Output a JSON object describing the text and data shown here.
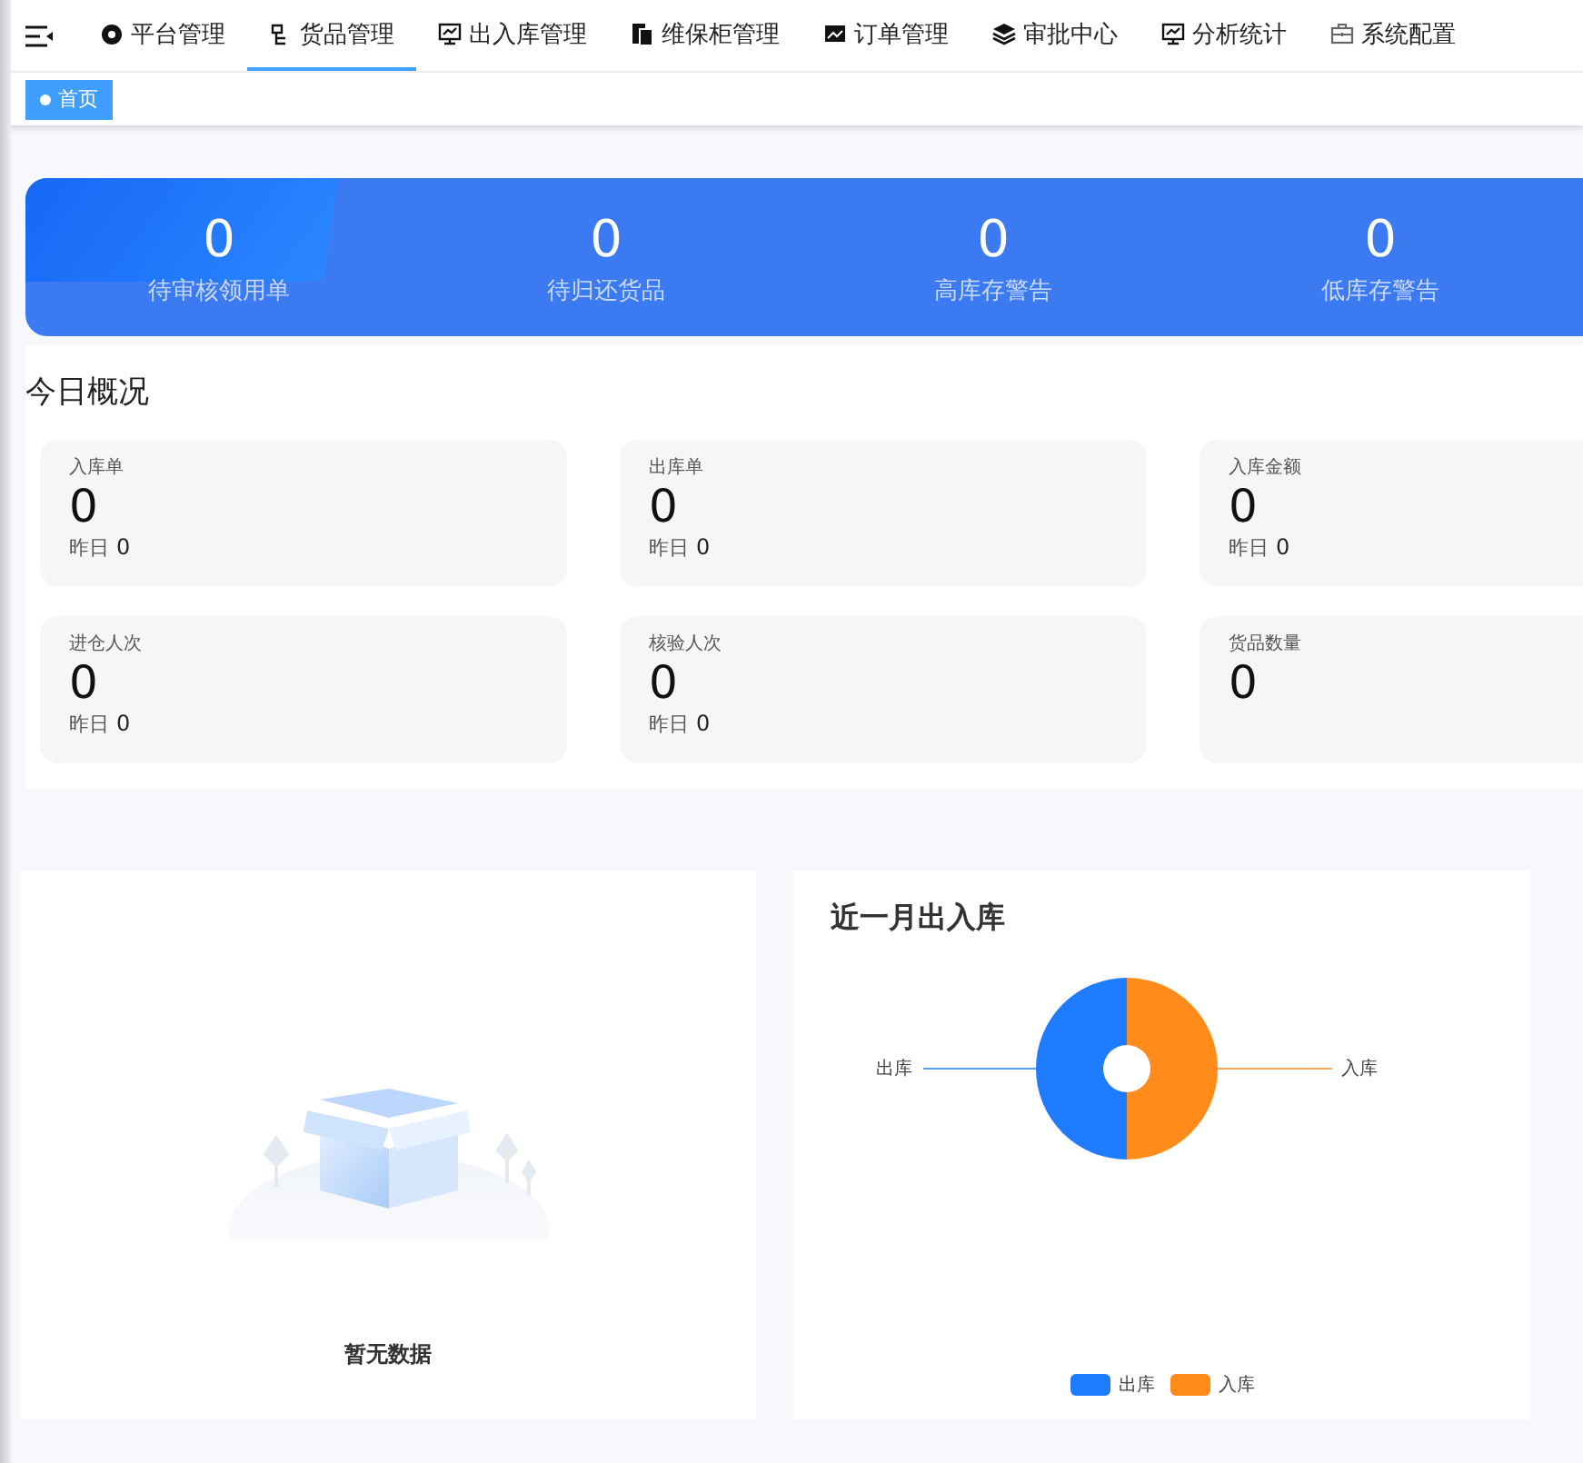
{
  "nav": {
    "items": [
      {
        "label": "平台管理",
        "selected": false
      },
      {
        "label": "货品管理",
        "selected": true
      },
      {
        "label": "出入库管理",
        "selected": false
      },
      {
        "label": "维保柜管理",
        "selected": false
      },
      {
        "label": "订单管理",
        "selected": false
      },
      {
        "label": "审批中心",
        "selected": false
      },
      {
        "label": "分析统计",
        "selected": false
      },
      {
        "label": "系统配置",
        "selected": false
      }
    ]
  },
  "tags": [
    {
      "label": "首页",
      "selected": true
    }
  ],
  "banner": {
    "items": [
      {
        "value": "0",
        "label": "待审核领用单"
      },
      {
        "value": "0",
        "label": "待归还货品"
      },
      {
        "value": "0",
        "label": "高库存警告"
      },
      {
        "value": "0",
        "label": "低库存警告"
      }
    ]
  },
  "today": {
    "title": "今日概况",
    "cards": [
      {
        "label": "入库单",
        "value": "0",
        "yesterday_label": "昨日",
        "yesterday_value": "0"
      },
      {
        "label": "出库单",
        "value": "0",
        "yesterday_label": "昨日",
        "yesterday_value": "0"
      },
      {
        "label": "入库金额",
        "value": "0",
        "yesterday_label": "昨日",
        "yesterday_value": "0"
      },
      {
        "label": "进仓人次",
        "value": "0",
        "yesterday_label": "昨日",
        "yesterday_value": "0"
      },
      {
        "label": "核验人次",
        "value": "0",
        "yesterday_label": "昨日",
        "yesterday_value": "0"
      },
      {
        "label": "货品数量",
        "value": "0"
      }
    ]
  },
  "empty_panel": {
    "message": "暂无数据"
  },
  "chart_panel": {
    "title": "近一月出入库",
    "chart_data": {
      "type": "donut",
      "categories": [
        "出库",
        "入库"
      ],
      "values": [
        0.5,
        0.5
      ],
      "colors": [
        "#1f7bff",
        "#ff8c1a"
      ]
    }
  }
}
